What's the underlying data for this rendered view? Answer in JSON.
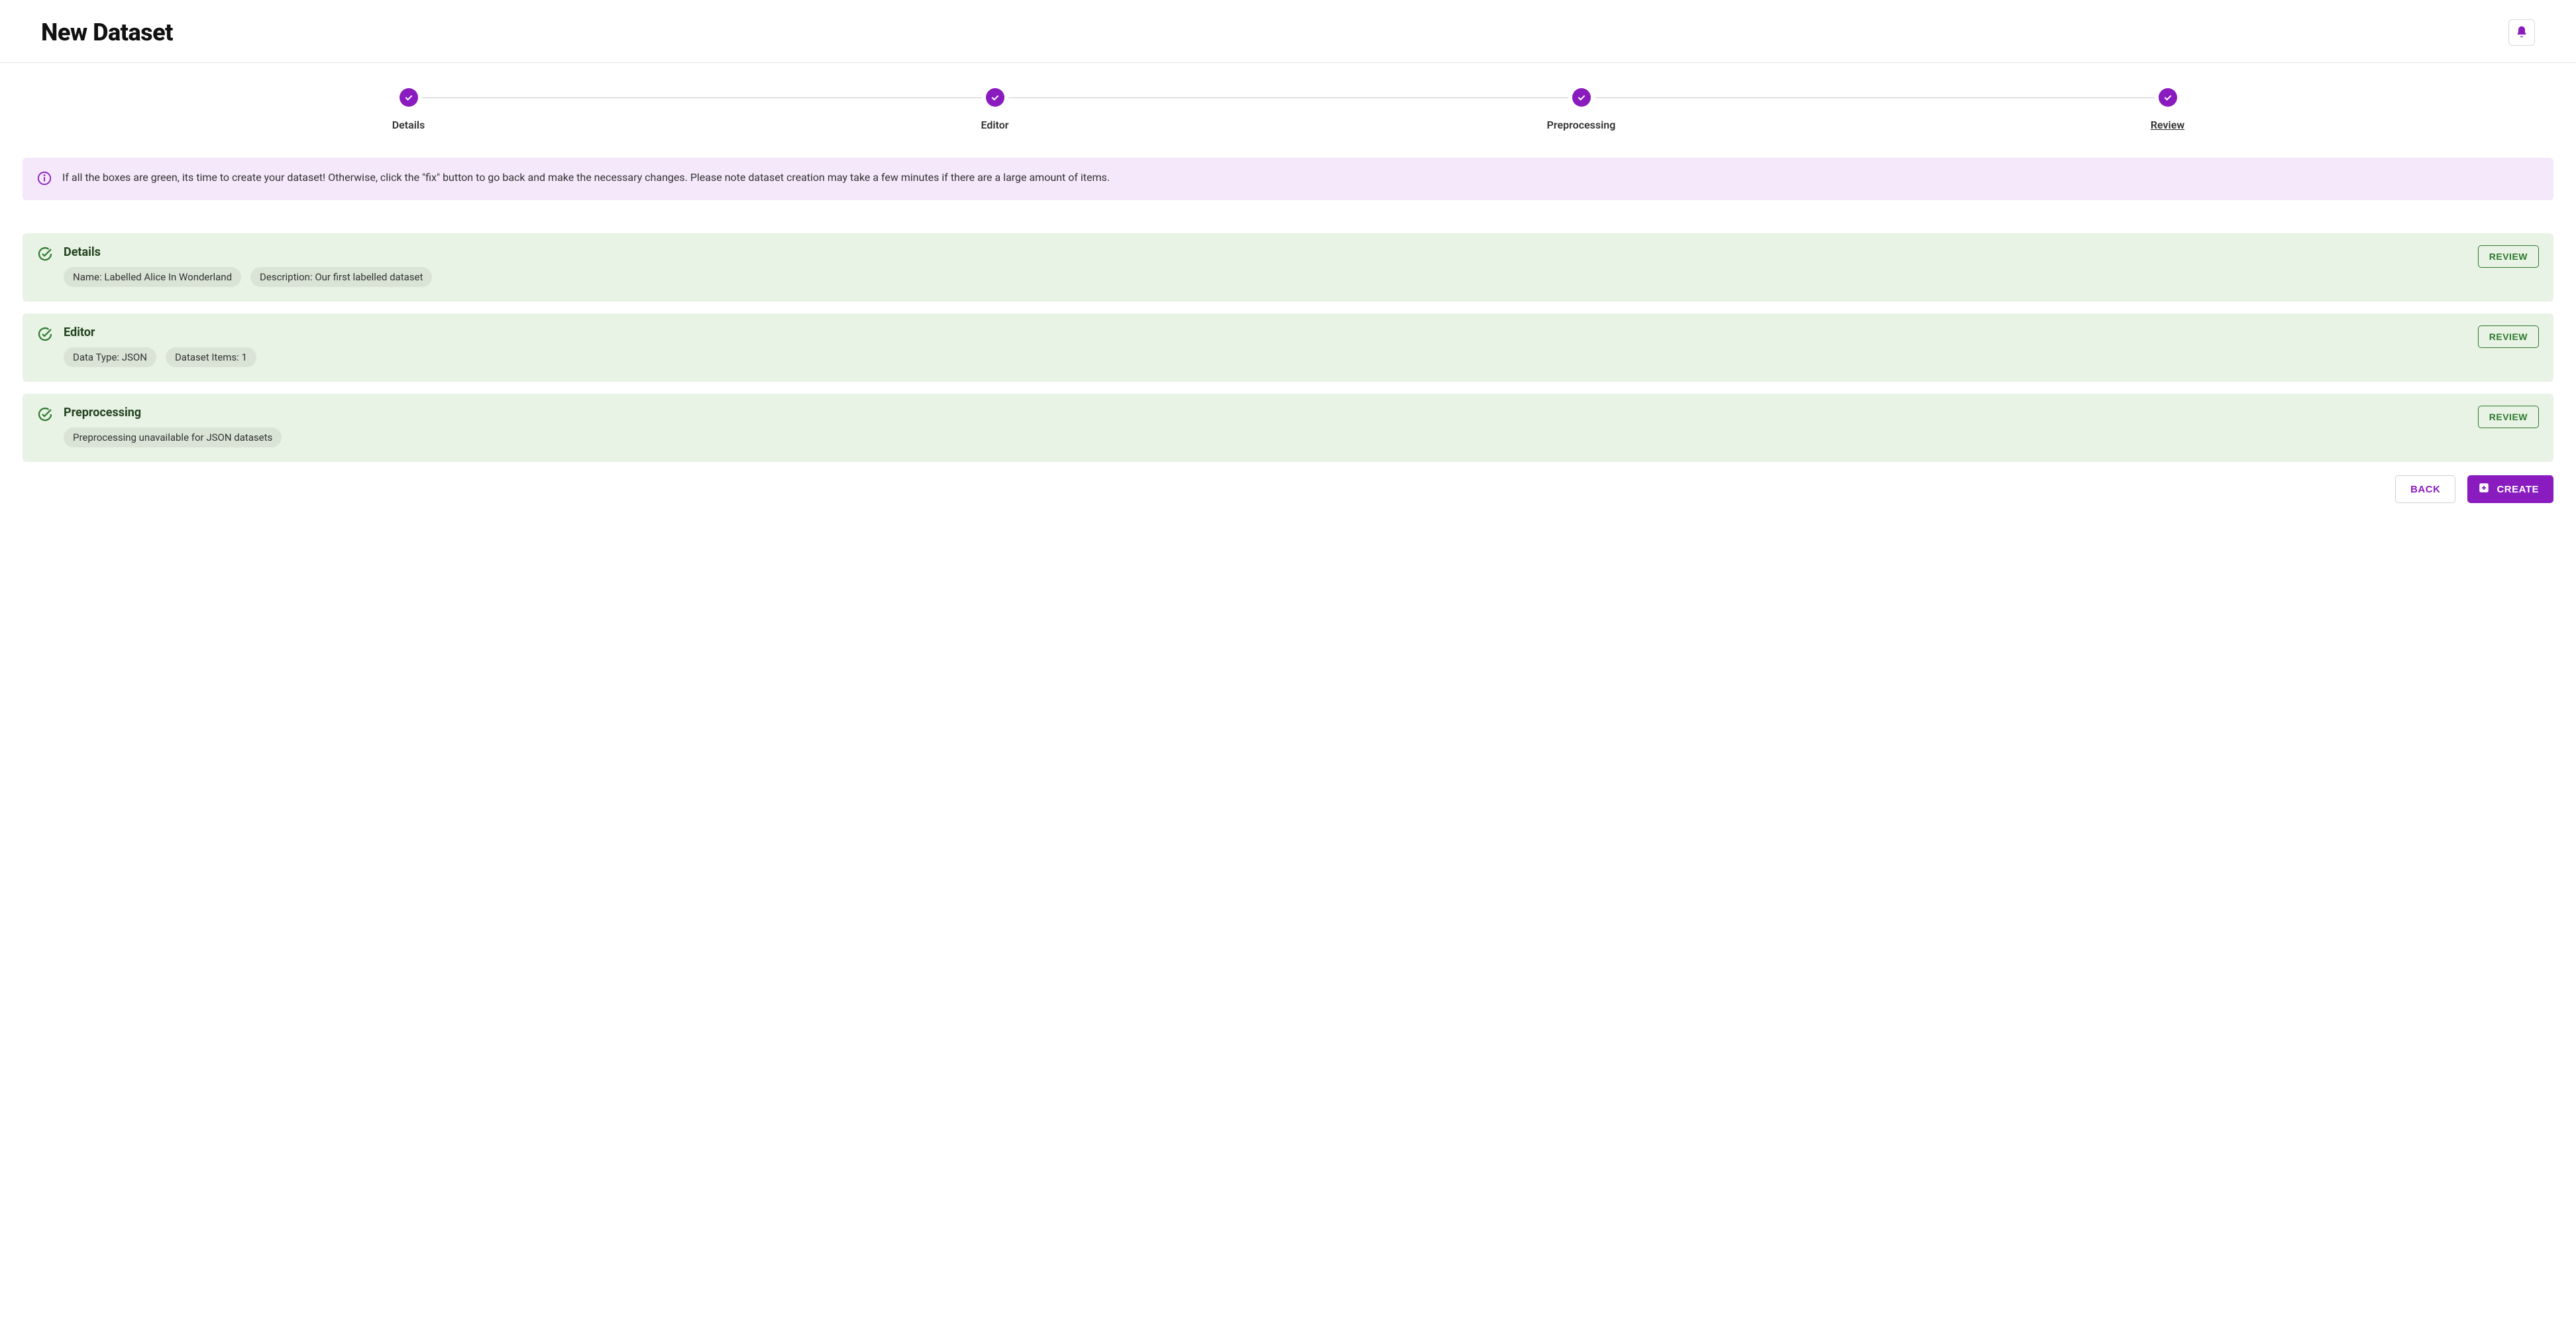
{
  "header": {
    "title": "New Dataset"
  },
  "stepper": {
    "steps": [
      {
        "label": "Details",
        "completed": true,
        "active": false
      },
      {
        "label": "Editor",
        "completed": true,
        "active": false
      },
      {
        "label": "Preprocessing",
        "completed": true,
        "active": false
      },
      {
        "label": "Review",
        "completed": true,
        "active": true
      }
    ]
  },
  "info_banner": {
    "text": "If all the boxes are green, its time to create your dataset! Otherwise, click the \"fix\" button to go back and make the necessary changes. Please note dataset creation may take a few minutes if there are a large amount of items."
  },
  "review": {
    "details": {
      "title": "Details",
      "chips": [
        "Name: Labelled Alice In Wonderland",
        "Description: Our first labelled dataset"
      ],
      "button": "REVIEW"
    },
    "editor": {
      "title": "Editor",
      "chips": [
        "Data Type: JSON",
        "Dataset Items: 1"
      ],
      "button": "REVIEW"
    },
    "preprocessing": {
      "title": "Preprocessing",
      "chips": [
        "Preprocessing unavailable for JSON datasets"
      ],
      "button": "REVIEW"
    }
  },
  "footer": {
    "back": "BACK",
    "create": "CREATE"
  },
  "colors": {
    "accent": "#8a1bbf",
    "success": "#2d7a2d",
    "banner_bg": "#f4e8fa",
    "card_bg": "#e8f2e5"
  }
}
